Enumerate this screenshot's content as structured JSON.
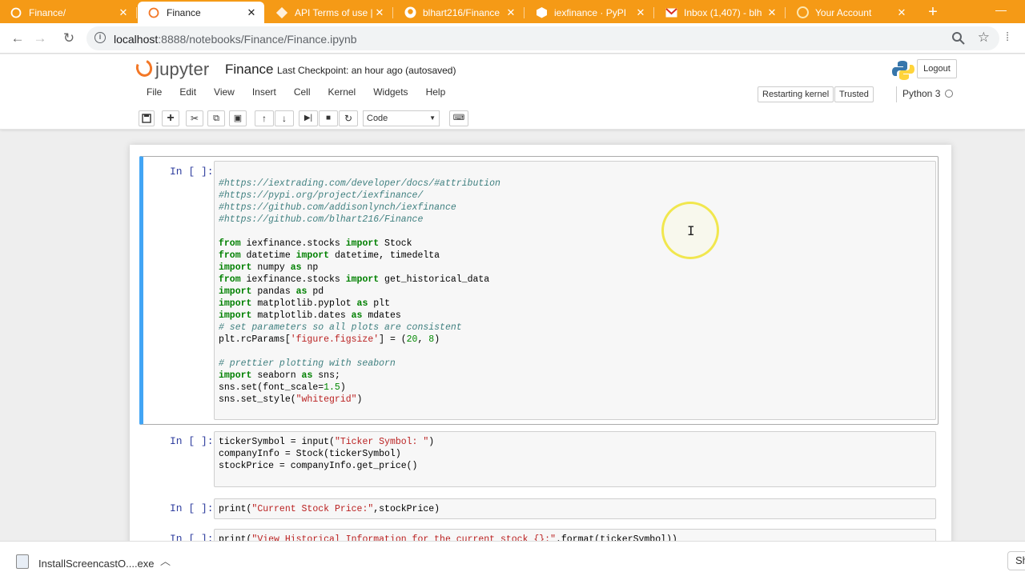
{
  "tabs": [
    {
      "title": "Finance/",
      "icon": "jupyter-icon"
    },
    {
      "title": "Finance",
      "icon": "jupyter-icon"
    },
    {
      "title": "API Terms of use |",
      "icon": "iex-icon"
    },
    {
      "title": "blhart216/Finance",
      "icon": "github-icon"
    },
    {
      "title": "iexfinance · PyPI",
      "icon": "pypi-icon"
    },
    {
      "title": "Inbox (1,407) - blh",
      "icon": "gmail-icon"
    },
    {
      "title": "Your Account",
      "icon": "account-icon"
    }
  ],
  "address": {
    "host": "localhost",
    "path": ":8888/notebooks/Finance/Finance.ipynb"
  },
  "jupyter": {
    "logo_text": "jupyter",
    "notebook_name": "Finance",
    "checkpoint": "Last Checkpoint: an hour ago (autosaved)",
    "logout": "Logout",
    "menu": [
      "File",
      "Edit",
      "View",
      "Insert",
      "Cell",
      "Kernel",
      "Widgets",
      "Help"
    ],
    "kernel_status": "Restarting kernel",
    "trusted": "Trusted",
    "kernel_name": "Python 3",
    "cell_type": "Code"
  },
  "cells": [
    {
      "prompt": "In [ ]:",
      "lines": [
        "",
        "#https://iextrading.com/developer/docs/#attribution",
        "#https://pypi.org/project/iexfinance/",
        "#https://github.com/addisonlynch/iexfinance",
        "#https://github.com/blhart216/Finance",
        "",
        "from iexfinance.stocks import Stock",
        "from datetime import datetime, timedelta",
        "import numpy as np",
        "from iexfinance.stocks import get_historical_data",
        "import pandas as pd",
        "import matplotlib.pyplot as plt",
        "import matplotlib.dates as mdates",
        "# set parameters so all plots are consistent",
        "plt.rcParams['figure.figsize'] = (20, 8)",
        "",
        "# prettier plotting with seaborn",
        "import seaborn as sns;",
        "sns.set(font_scale=1.5)",
        "sns.set_style(\"whitegrid\")"
      ]
    },
    {
      "prompt": "In [ ]:",
      "lines": [
        "tickerSymbol = input(\"Ticker Symbol: \")",
        "companyInfo = Stock(tickerSymbol)",
        "stockPrice = companyInfo.get_price()"
      ]
    },
    {
      "prompt": "In [ ]:",
      "lines": [
        "print(\"Current Stock Price:\",stockPrice)"
      ]
    },
    {
      "prompt": "In [ ]:",
      "lines": [
        "print(\"View Historical Information for the current stock {}:\".format(tickerSymbol))"
      ]
    }
  ],
  "download": {
    "filename": "InstallScreencastO....exe",
    "show_all": "Sh"
  },
  "colors": {
    "tabbar": "#f59a16",
    "selected_cell": "#42a5f5",
    "prompt": "#303f9f"
  }
}
